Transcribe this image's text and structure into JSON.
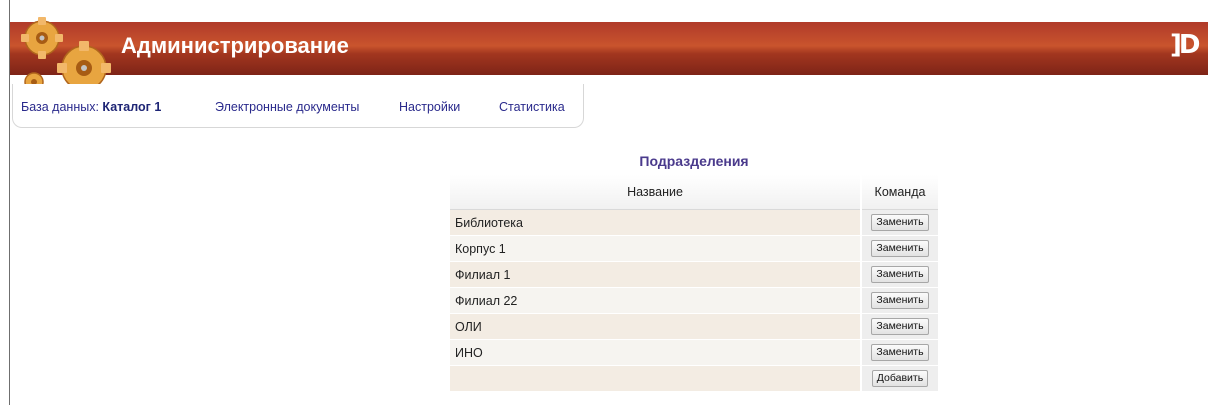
{
  "header": {
    "title": "Администрирование",
    "logo_text": "]D",
    "accent_color": "#b03a2a"
  },
  "nav": {
    "db_label": "База данных:",
    "db_value": "Каталог 1",
    "items": [
      "Электронные документы",
      "Настройки",
      "Статистика"
    ]
  },
  "section": {
    "title": "Подразделения"
  },
  "table": {
    "columns": [
      "Название",
      "Команда"
    ],
    "rows": [
      {
        "name": "Библиотека",
        "action": "Заменить"
      },
      {
        "name": "Корпус 1",
        "action": "Заменить"
      },
      {
        "name": "Филиал 1",
        "action": "Заменить"
      },
      {
        "name": "Филиал 22",
        "action": "Заменить"
      },
      {
        "name": "ОЛИ",
        "action": "Заменить"
      },
      {
        "name": "ИНО",
        "action": "Заменить"
      }
    ],
    "add_label": "Добавить"
  }
}
